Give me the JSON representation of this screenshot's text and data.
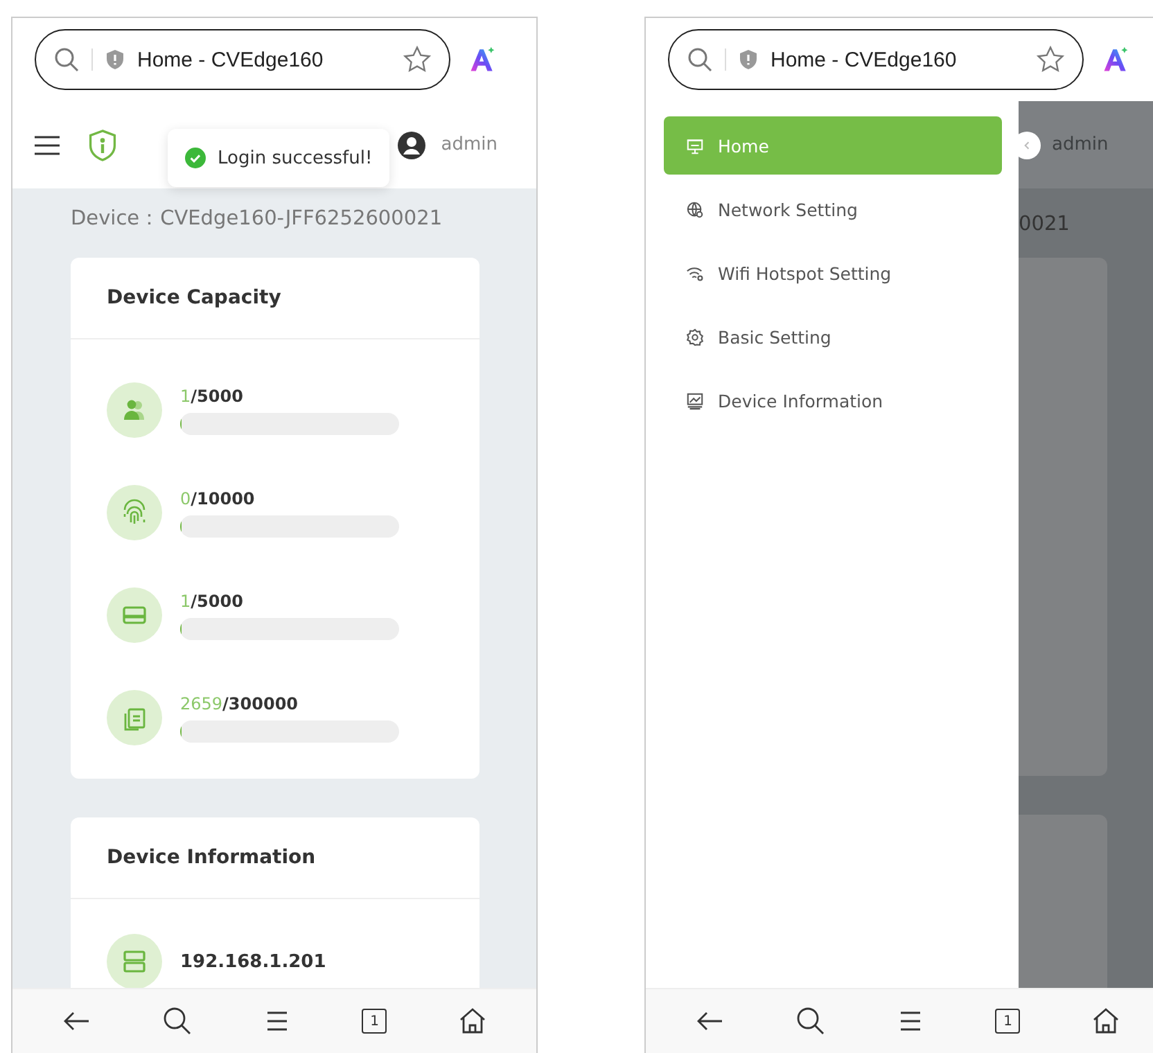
{
  "left_phone": {
    "address_bar": {
      "title": "Home - CVEdge160"
    },
    "header": {
      "user": "admin"
    },
    "toast": {
      "message": "Login successful!"
    },
    "device_label": "Device：CVEdge160-JFF6252600021",
    "capacity_card": {
      "title": "Device Capacity",
      "items": [
        {
          "kind": "user",
          "used": "1",
          "total": "/5000",
          "level": 0.0002
        },
        {
          "kind": "fingerprint",
          "used": "0",
          "total": "/10000",
          "level": 0
        },
        {
          "kind": "card",
          "used": "1",
          "total": "/5000",
          "level": 0.0002
        },
        {
          "kind": "record",
          "used": "2659",
          "total": "/300000",
          "level": 0.009
        }
      ]
    },
    "info_card": {
      "title": "Device Information",
      "items": [
        {
          "kind": "server",
          "value": "192.168.1.201"
        }
      ]
    },
    "bottom_nav": {
      "tab_count": "1"
    }
  },
  "right_phone": {
    "address_bar": {
      "title": "Home - CVEdge160"
    },
    "drawer": {
      "items": [
        {
          "kind": "home",
          "label": "Home",
          "selected": true
        },
        {
          "kind": "network",
          "label": "Network Setting",
          "selected": false
        },
        {
          "kind": "wifi",
          "label": "Wifi Hotspot Setting",
          "selected": false
        },
        {
          "kind": "settings",
          "label": "Basic Setting",
          "selected": false
        },
        {
          "kind": "info",
          "label": "Device Information",
          "selected": false
        }
      ]
    },
    "dimmed_page": {
      "user": "admin",
      "device_label_fragment": "0021"
    },
    "bottom_nav": {
      "tab_count": "1"
    }
  }
}
